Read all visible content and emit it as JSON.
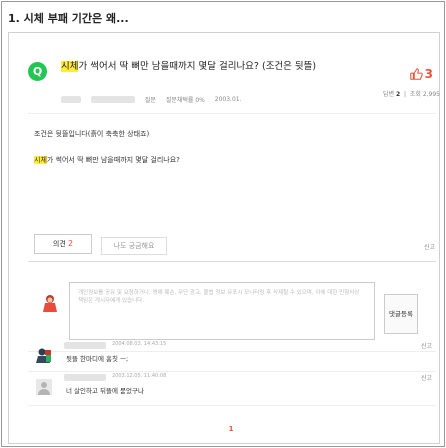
{
  "header": {
    "title": "1. 시체 부패 기간은 왜..."
  },
  "question": {
    "logo_letter": "Q",
    "title_highlight": "시체",
    "title_rest": "가 썩어서 딱 뼈만 남을때까지 몇달 걸리나요? (조건은 뒷뜰)",
    "meta": {
      "label_question": "질문",
      "grade_label": "질문채택률 0%",
      "date": "2003.01."
    },
    "likes": "3",
    "answers_label": "답변",
    "answers_count": "2",
    "views_label": "조회",
    "views_count": "2,995",
    "body_line1": "조건은 뒷뜰입니다(흙이 축축한 상태죠)",
    "body_line2_highlight": "시체",
    "body_line2_rest": "가 썩어서 딱 뼈만 남을때까지 몇달 걸리나요?"
  },
  "actions": {
    "opinion_label": "의견",
    "opinion_count": "2",
    "curious_label": "나도 궁금해요",
    "report_label": "신고"
  },
  "comment_form": {
    "placeholder": "개인정보를 공유 및 요청하거나, 명예 훼손, 무단 광고, 불법 정보 유포시 모니터링 후 삭제될 수 있으며, 이에 대한 민형사상 책임은 게시자에게 있습니다.",
    "submit_label": "댓글등록"
  },
  "replies": [
    {
      "date": "2004.08.03. 14:43:15",
      "text": "뒷뜰 한마디에 훔칫 ㅡ;",
      "report_label": "신고"
    },
    {
      "date": "2003.12.05. 11:40:08",
      "text": "너 살인하고 뒤뜰에 묻었구나",
      "report_label": "신고"
    }
  ],
  "pagination": {
    "current": "1"
  },
  "colors": {
    "accent": "#e8533a",
    "logo": "#23c653",
    "highlight": "#ffec3d"
  }
}
